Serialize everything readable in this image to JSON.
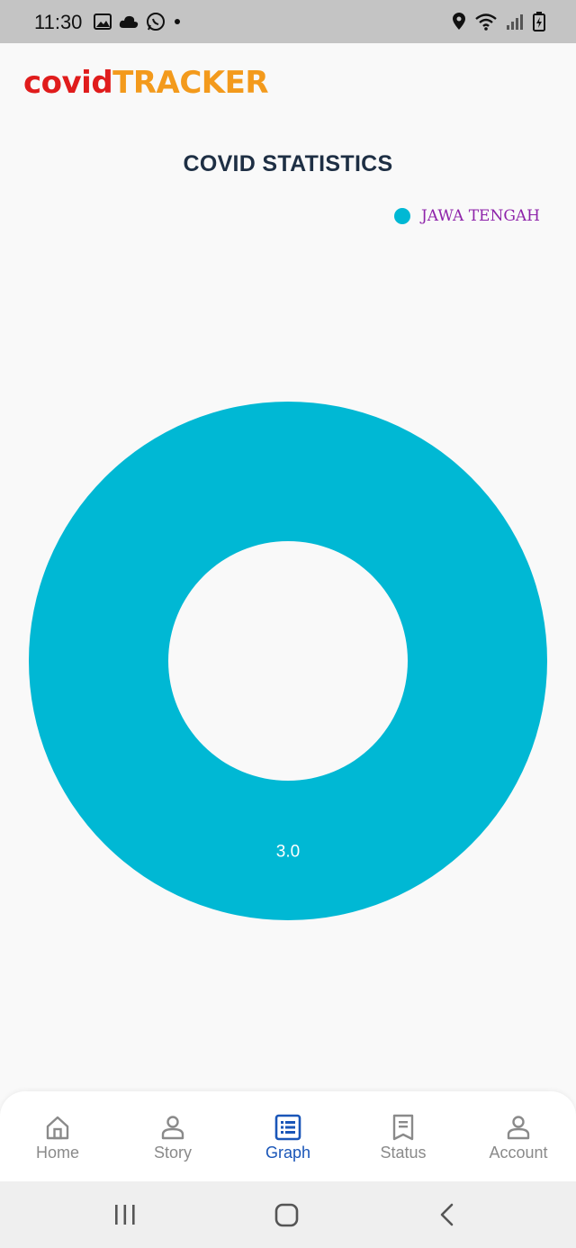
{
  "status_bar": {
    "time": "11:30"
  },
  "header": {
    "logo_part1": "covid",
    "logo_part2": "TRACKER"
  },
  "page": {
    "title": "COVID STATISTICS"
  },
  "colors": {
    "series": "#00b8d4",
    "legend_text": "#8e24aa",
    "nav_active": "#1a56b8"
  },
  "chart_data": {
    "type": "pie",
    "donut": true,
    "legend_position": "top-right",
    "series": [
      {
        "name": "JAWA TENGAH",
        "value": 3.0,
        "label": "3.0",
        "color": "#00b8d4"
      }
    ]
  },
  "bottom_nav": {
    "items": [
      {
        "label": "Home",
        "icon": "home-icon"
      },
      {
        "label": "Story",
        "icon": "person-icon"
      },
      {
        "label": "Graph",
        "icon": "list-icon",
        "active": true
      },
      {
        "label": "Status",
        "icon": "receipt-icon"
      },
      {
        "label": "Account",
        "icon": "account-icon"
      }
    ]
  }
}
